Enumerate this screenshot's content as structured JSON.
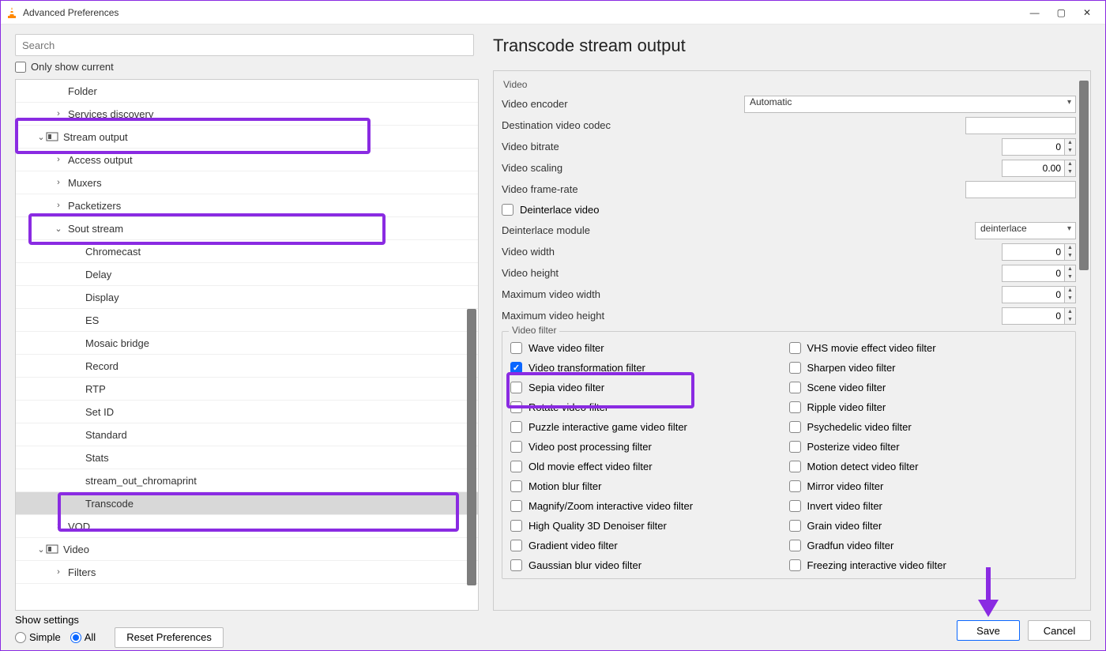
{
  "window": {
    "title": "Advanced Preferences",
    "minimize": "—",
    "maximize": "▢",
    "close": "✕"
  },
  "search": {
    "placeholder": "Search"
  },
  "only_current_label": "Only show current",
  "tree": [
    {
      "label": "Folder",
      "indent": 48,
      "chev": ""
    },
    {
      "label": "Services discovery",
      "indent": 48,
      "chev": "›"
    },
    {
      "label": "Stream output",
      "indent": 26,
      "chev": "⌄",
      "icon": true
    },
    {
      "label": "Access output",
      "indent": 48,
      "chev": "›"
    },
    {
      "label": "Muxers",
      "indent": 48,
      "chev": "›"
    },
    {
      "label": "Packetizers",
      "indent": 48,
      "chev": "›"
    },
    {
      "label": "Sout stream",
      "indent": 48,
      "chev": "⌄"
    },
    {
      "label": "Chromecast",
      "indent": 70,
      "chev": ""
    },
    {
      "label": "Delay",
      "indent": 70,
      "chev": ""
    },
    {
      "label": "Display",
      "indent": 70,
      "chev": ""
    },
    {
      "label": "ES",
      "indent": 70,
      "chev": ""
    },
    {
      "label": "Mosaic bridge",
      "indent": 70,
      "chev": ""
    },
    {
      "label": "Record",
      "indent": 70,
      "chev": ""
    },
    {
      "label": "RTP",
      "indent": 70,
      "chev": ""
    },
    {
      "label": "Set ID",
      "indent": 70,
      "chev": ""
    },
    {
      "label": "Standard",
      "indent": 70,
      "chev": ""
    },
    {
      "label": "Stats",
      "indent": 70,
      "chev": ""
    },
    {
      "label": "stream_out_chromaprint",
      "indent": 70,
      "chev": ""
    },
    {
      "label": "Transcode",
      "indent": 70,
      "chev": "",
      "selected": true
    },
    {
      "label": "VOD",
      "indent": 48,
      "chev": "›"
    },
    {
      "label": "Video",
      "indent": 26,
      "chev": "⌄",
      "icon": true
    },
    {
      "label": "Filters",
      "indent": 48,
      "chev": "›"
    }
  ],
  "page_title": "Transcode stream output",
  "sections": {
    "video": "Video",
    "video_filter": "Video filter"
  },
  "fields": {
    "video_encoder": {
      "label": "Video encoder",
      "value": "Automatic"
    },
    "dest_codec": {
      "label": "Destination video codec",
      "value": ""
    },
    "bitrate": {
      "label": "Video bitrate",
      "value": "0"
    },
    "scaling": {
      "label": "Video scaling",
      "value": "0.00"
    },
    "framerate": {
      "label": "Video frame-rate",
      "value": ""
    },
    "deinterlace": {
      "label": "Deinterlace video",
      "checked": false
    },
    "deint_module": {
      "label": "Deinterlace module",
      "value": "deinterlace"
    },
    "width": {
      "label": "Video width",
      "value": "0"
    },
    "height": {
      "label": "Video height",
      "value": "0"
    },
    "max_width": {
      "label": "Maximum video width",
      "value": "0"
    },
    "max_height": {
      "label": "Maximum video height",
      "value": "0"
    }
  },
  "filters_left": [
    {
      "label": "Wave video filter",
      "checked": false
    },
    {
      "label": "Video transformation filter",
      "checked": true
    },
    {
      "label": "Sepia video filter",
      "checked": false
    },
    {
      "label": "Rotate video filter",
      "checked": false
    },
    {
      "label": "Puzzle interactive game video filter",
      "checked": false
    },
    {
      "label": "Video post processing filter",
      "checked": false
    },
    {
      "label": "Old movie effect video filter",
      "checked": false
    },
    {
      "label": "Motion blur filter",
      "checked": false
    },
    {
      "label": "Magnify/Zoom interactive video filter",
      "checked": false
    },
    {
      "label": "High Quality 3D Denoiser filter",
      "checked": false
    },
    {
      "label": "Gradient video filter",
      "checked": false
    },
    {
      "label": "Gaussian blur video filter",
      "checked": false
    }
  ],
  "filters_right": [
    {
      "label": "VHS movie effect video filter",
      "checked": false
    },
    {
      "label": "Sharpen video filter",
      "checked": false
    },
    {
      "label": "Scene video filter",
      "checked": false
    },
    {
      "label": "Ripple video filter",
      "checked": false
    },
    {
      "label": "Psychedelic video filter",
      "checked": false
    },
    {
      "label": "Posterize video filter",
      "checked": false
    },
    {
      "label": "Motion detect video filter",
      "checked": false
    },
    {
      "label": "Mirror video filter",
      "checked": false
    },
    {
      "label": "Invert video filter",
      "checked": false
    },
    {
      "label": "Grain video filter",
      "checked": false
    },
    {
      "label": "Gradfun video filter",
      "checked": false
    },
    {
      "label": "Freezing interactive video filter",
      "checked": false
    }
  ],
  "footer": {
    "show_settings": "Show settings",
    "simple": "Simple",
    "all": "All",
    "reset": "Reset Preferences",
    "save": "Save",
    "cancel": "Cancel"
  }
}
